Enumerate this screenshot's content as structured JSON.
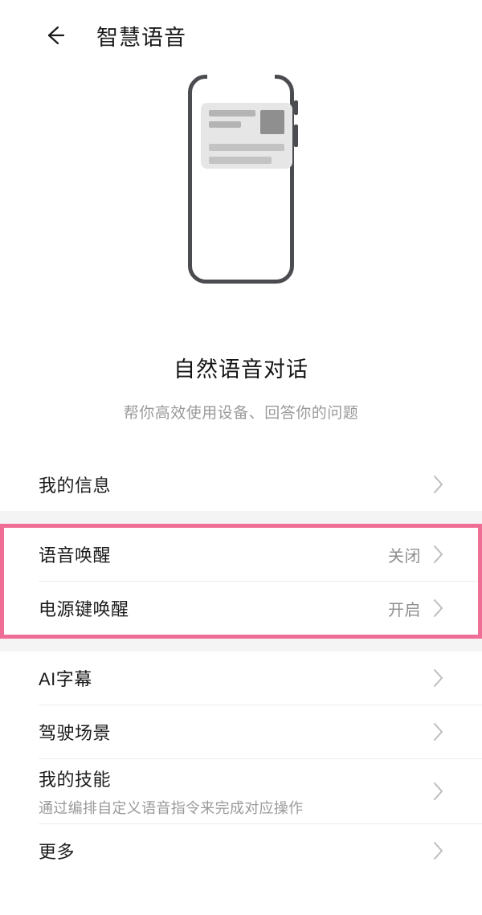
{
  "header": {
    "title": "智慧语音",
    "back_icon": "back-arrow-icon"
  },
  "hero": {
    "illustration": "phone-with-message-card-illustration",
    "title": "自然语音对话",
    "subtitle": "帮你高效使用设备、回答你的问题"
  },
  "colors": {
    "highlight_border": "#ef6e96",
    "divider": "#ededed",
    "section_band": "#f4f4f4",
    "label": "#1b1b1b",
    "muted": "#9a9a9a"
  },
  "list": {
    "section_1": [
      {
        "label": "我的信息",
        "value": "",
        "desc": "",
        "chevron": "chevron-right-icon"
      }
    ],
    "highlighted_section": [
      {
        "label": "语音唤醒",
        "value": "关闭",
        "desc": "",
        "chevron": "chevron-right-icon"
      },
      {
        "label": "电源键唤醒",
        "value": "开启",
        "desc": "",
        "chevron": "chevron-right-icon"
      }
    ],
    "section_3": [
      {
        "label": "AI字幕",
        "value": "",
        "desc": "",
        "chevron": "chevron-right-icon"
      },
      {
        "label": "驾驶场景",
        "value": "",
        "desc": "",
        "chevron": "chevron-right-icon"
      },
      {
        "label": "我的技能",
        "value": "",
        "desc": "通过编排自定义语音指令来完成对应操作",
        "chevron": "chevron-right-icon"
      },
      {
        "label": "更多",
        "value": "",
        "desc": "",
        "chevron": "chevron-right-icon"
      }
    ]
  }
}
